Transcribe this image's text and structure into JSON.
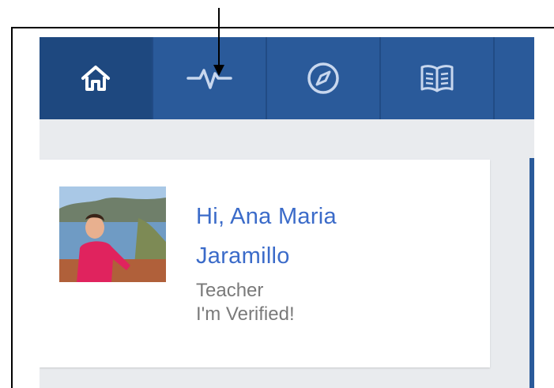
{
  "nav": {
    "items": [
      {
        "icon": "home-icon",
        "active": true
      },
      {
        "icon": "activity-icon",
        "active": false
      },
      {
        "icon": "compass-icon",
        "active": false
      },
      {
        "icon": "book-icon",
        "active": false
      }
    ]
  },
  "profile": {
    "greeting_line1": "Hi, Ana Maria",
    "greeting_line2": "Jaramillo",
    "role": "Teacher",
    "status": "I'm Verified!"
  },
  "colors": {
    "navbar": "#2a5a9a",
    "navbar_active": "#1e487f",
    "name_text": "#3b6bc9",
    "meta_text": "#7a7a7a",
    "page_bg": "#e9ebee"
  }
}
